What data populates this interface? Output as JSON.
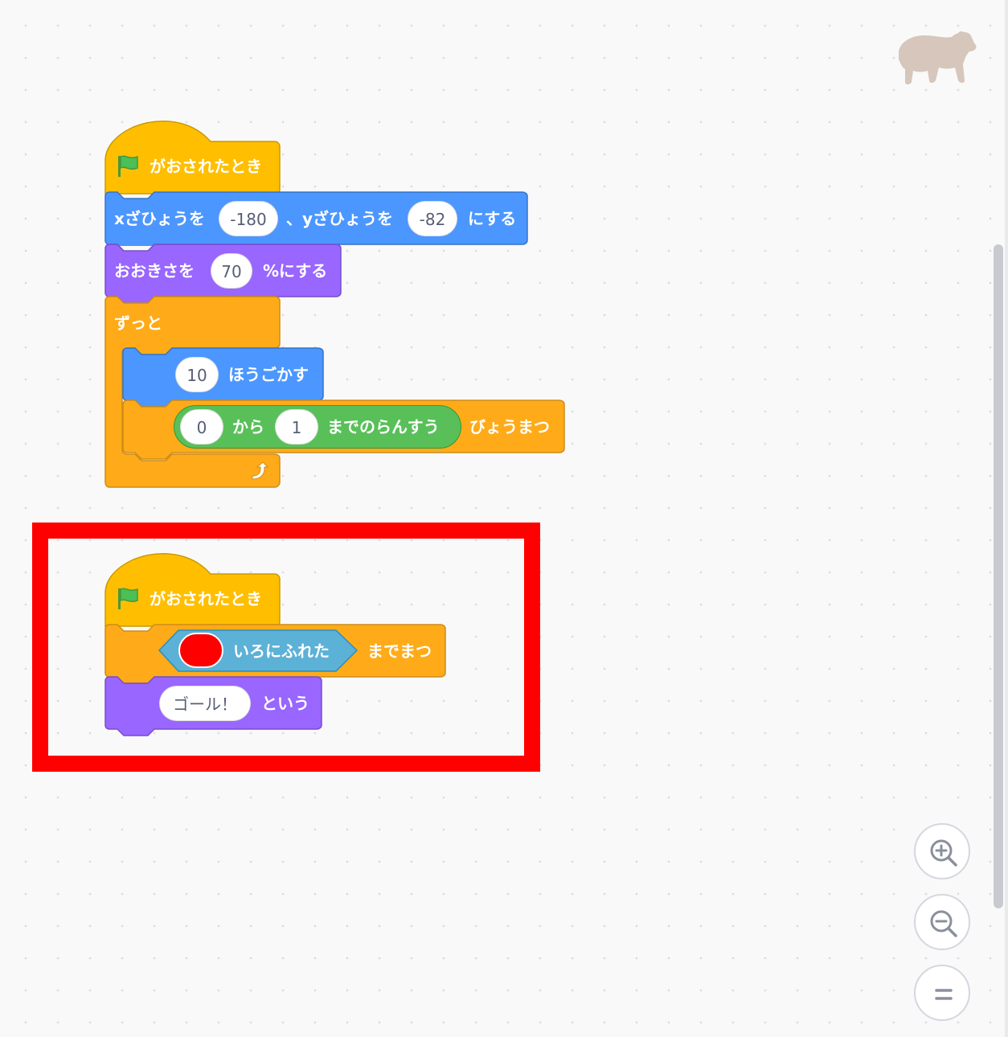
{
  "script1": {
    "hat_label": "がおされたとき",
    "goto": {
      "label_x": "xざひょうを",
      "x_value": "-180",
      "label_y": "、yざひょうを",
      "y_value": "-82",
      "label_end": "にする"
    },
    "size": {
      "label": "おおきさを",
      "value": "70",
      "label_end": "%にする"
    },
    "forever_label": "ずっと",
    "move": {
      "value": "10",
      "label": "ほうごかす"
    },
    "wait": {
      "from_value": "0",
      "from_label": "から",
      "to_value": "1",
      "random_label": "までのらんすう",
      "label_end": "びょうまつ"
    }
  },
  "script2": {
    "hat_label": "がおされたとき",
    "wait_until": {
      "touching_label": "いろにふれた",
      "label_end": "までまつ",
      "color": "#ff0000"
    },
    "say": {
      "value": "ゴール！",
      "label": "という"
    }
  },
  "colors": {
    "events": "#ffbf00",
    "motion": "#4c97ff",
    "looks": "#9966ff",
    "control": "#ffab19",
    "operators": "#59c059",
    "sensing": "#5cb1d6",
    "highlight": "#ff0000",
    "background": "#f9f9f9"
  },
  "sprite": {
    "icon": "bear-icon",
    "color": "#d6c6bc"
  },
  "zoom_controls": {
    "in_icon": "zoom-in-icon",
    "out_icon": "zoom-out-icon",
    "reset_icon": "zoom-reset-icon"
  }
}
